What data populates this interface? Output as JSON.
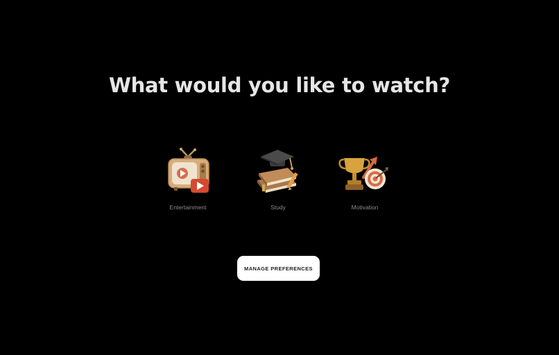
{
  "title": "What would you like to watch?",
  "options": [
    {
      "label": "Entertainment",
      "icon": "tv-icon"
    },
    {
      "label": "Study",
      "icon": "graduation-cap-books-icon"
    },
    {
      "label": "Motivation",
      "icon": "trophy-target-icon"
    }
  ],
  "manage_button": {
    "label": "MANAGE PREFERENCES"
  },
  "colors": {
    "background": "#000000",
    "title": "#e6e6e6",
    "label": "#8c8c8c",
    "button_bg": "#ffffff",
    "button_text": "#222222"
  }
}
